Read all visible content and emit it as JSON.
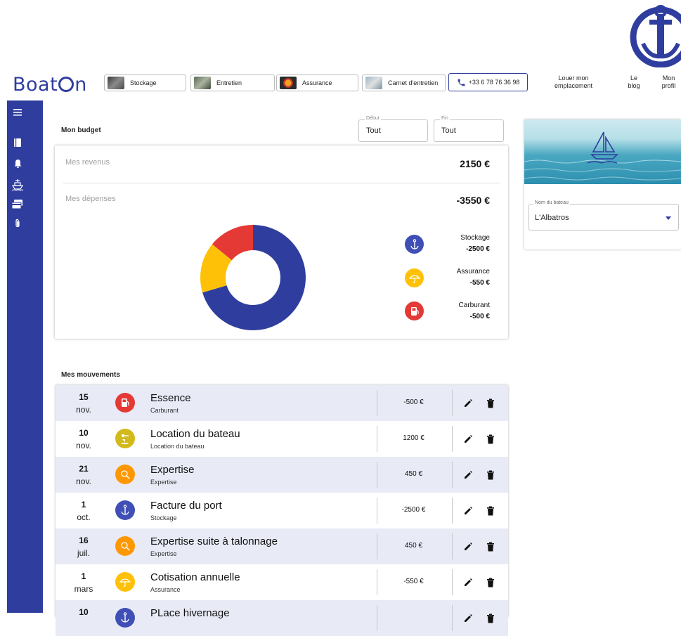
{
  "header": {
    "brand": "BoatⓊn",
    "brand_prefix": "Boat",
    "brand_suffix": "n",
    "nav": [
      {
        "label": "Stockage",
        "icon": "stockage-photo"
      },
      {
        "label": "Entretien",
        "icon": "entretien-photo"
      },
      {
        "label": "Assurance",
        "icon": "assurance-photo"
      },
      {
        "label": "Carnet d'entretien",
        "icon": "carnet-photo"
      }
    ],
    "phone": "+33 6 78 76 36 98",
    "links": [
      {
        "line1": "Louer mon",
        "line2": "emplacement"
      },
      {
        "line1": "Le",
        "line2": "blog"
      },
      {
        "line1": "Mon",
        "line2": "profil"
      }
    ],
    "accent": "#2f3e9e"
  },
  "sidebar": {
    "icons": [
      "menu-icon",
      "book-icon",
      "bell-icon",
      "ship-icon",
      "card-icon",
      "paperclip-icon"
    ]
  },
  "budget": {
    "title": "Mon budget",
    "start": {
      "label": "Début",
      "value": "Tout"
    },
    "end": {
      "label": "Fin",
      "value": "Tout"
    },
    "income_label": "Mes revenus",
    "income_value": "2150 €",
    "expense_label": "Mes dépenses",
    "expense_value": "-3550 €",
    "legend": [
      {
        "name": "Stockage",
        "amount": "-2500 €",
        "color": "#2f3e9e",
        "icon": "anchor-icon"
      },
      {
        "name": "Assurance",
        "amount": "-550 €",
        "color": "#ffc107",
        "icon": "umbrella-icon"
      },
      {
        "name": "Carburant",
        "amount": "-500 €",
        "color": "#e53935",
        "icon": "fuel-icon"
      }
    ]
  },
  "chart_data": {
    "type": "pie",
    "categories": [
      "Stockage",
      "Assurance",
      "Carburant"
    ],
    "values": [
      2500,
      550,
      500
    ],
    "colors": [
      "#2f3e9e",
      "#ffc107",
      "#e53935"
    ]
  },
  "boat": {
    "field_label": "Nom du bateau",
    "value": "L'Albatros"
  },
  "movements": {
    "title": "Mes mouvements",
    "rows": [
      {
        "day": "15",
        "month": "nov.",
        "title": "Essence",
        "category": "Carburant",
        "amount": "-500 €",
        "icon": "fuel-icon",
        "color": "#e53935"
      },
      {
        "day": "10",
        "month": "nov.",
        "title": "Location du bateau",
        "category": "Location du bateau",
        "amount": "1200 €",
        "icon": "key-boat-icon",
        "color": "#d4b91a"
      },
      {
        "day": "21",
        "month": "nov.",
        "title": "Expertise",
        "category": "Expertise",
        "amount": "450 €",
        "icon": "search-icon",
        "color": "#ff9800"
      },
      {
        "day": "1",
        "month": "oct.",
        "title": "Facture du port",
        "category": "Stockage",
        "amount": "-2500 €",
        "icon": "anchor-icon",
        "color": "#3f4fb5"
      },
      {
        "day": "16",
        "month": "juil.",
        "title": "Expertise suite à talonnage",
        "category": "Expertise",
        "amount": "450 €",
        "icon": "search-icon",
        "color": "#ff9800"
      },
      {
        "day": "1",
        "month": "mars",
        "title": "Cotisation annuelle",
        "category": "Assurance",
        "amount": "-550 €",
        "icon": "umbrella-icon",
        "color": "#ffc107"
      },
      {
        "day": "10",
        "month": "",
        "title": "PLace hivernage",
        "category": "",
        "amount": "",
        "icon": "anchor-icon",
        "color": "#3f4fb5"
      }
    ]
  }
}
